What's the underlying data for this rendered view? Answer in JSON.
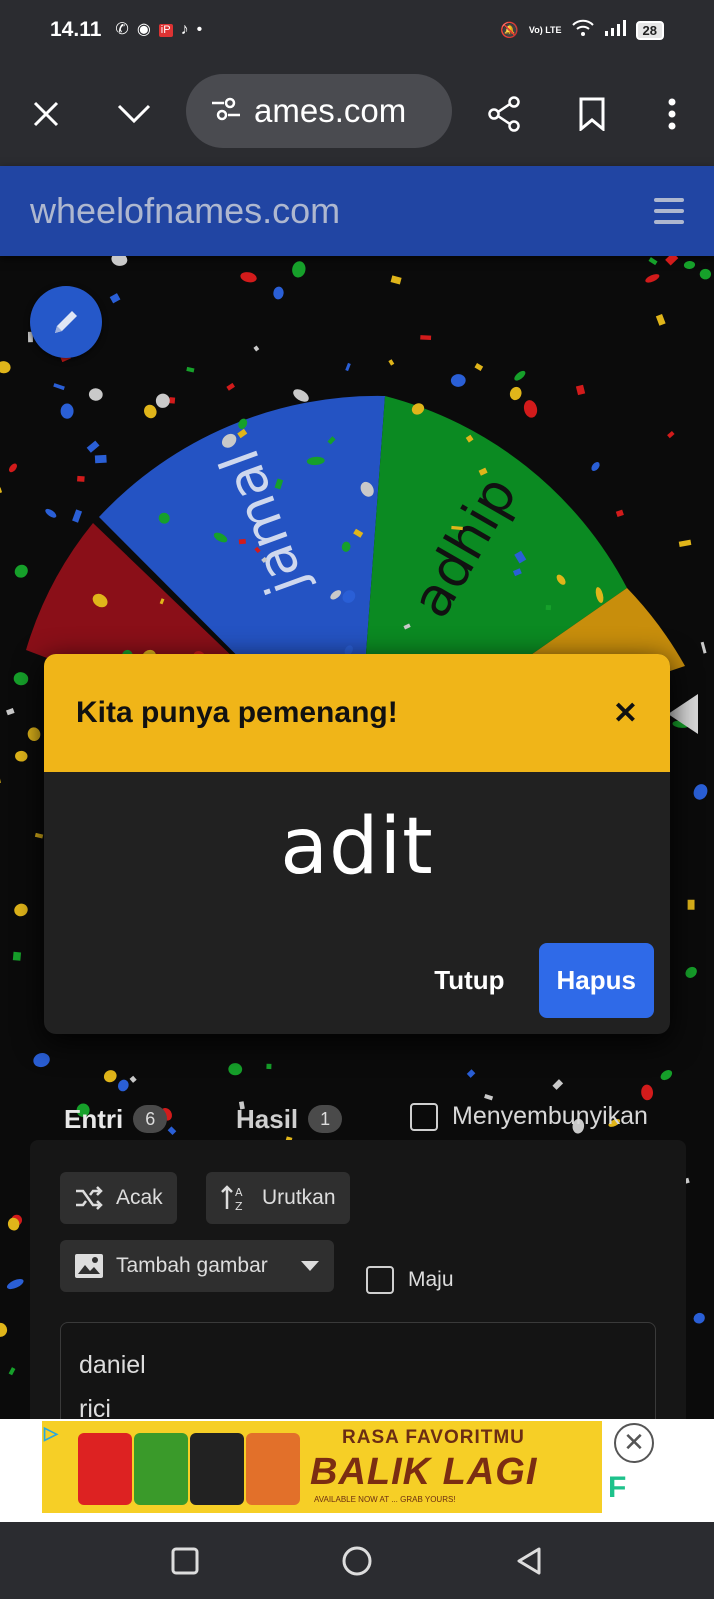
{
  "status_bar": {
    "time": "14.11",
    "notification_icons": [
      "whatsapp-icon",
      "chat-icon",
      "app-icon",
      "tiktok-icon",
      "more-dot"
    ],
    "battery": "28",
    "network": "Vo) LTE"
  },
  "browser": {
    "url": "ames.com"
  },
  "site": {
    "title": "wheelofnames.com"
  },
  "wheel": {
    "segments": [
      {
        "label": "jamal",
        "color": "#2453c3"
      },
      {
        "label": "adhip",
        "color": "#0b8a22"
      },
      {
        "label": "",
        "color": "#c88e0c"
      },
      {
        "label": "",
        "color": "#8a0f18"
      }
    ]
  },
  "dialog": {
    "title": "Kita punya pemenang!",
    "winner": "adit",
    "close_label": "Tutup",
    "remove_label": "Hapus"
  },
  "tabs": {
    "entries_label": "Entri",
    "entries_count": "6",
    "results_label": "Hasil",
    "results_count": "1",
    "hide_label": "Menyembunyikan"
  },
  "panel": {
    "shuffle_label": "Acak",
    "sort_label": "Urutkan",
    "add_image_label": "Tambah gambar",
    "advanced_label": "Maju",
    "entries": [
      "daniel",
      "rici"
    ]
  },
  "ad": {
    "line1": "RASA FAVORITMU",
    "line2": "BALIK LAGI",
    "line3": "AVAILABLE NOW AT ... GRAB YOURS!",
    "colors": {
      "banner": "#f6cf26",
      "text": "#7b2d12"
    }
  }
}
